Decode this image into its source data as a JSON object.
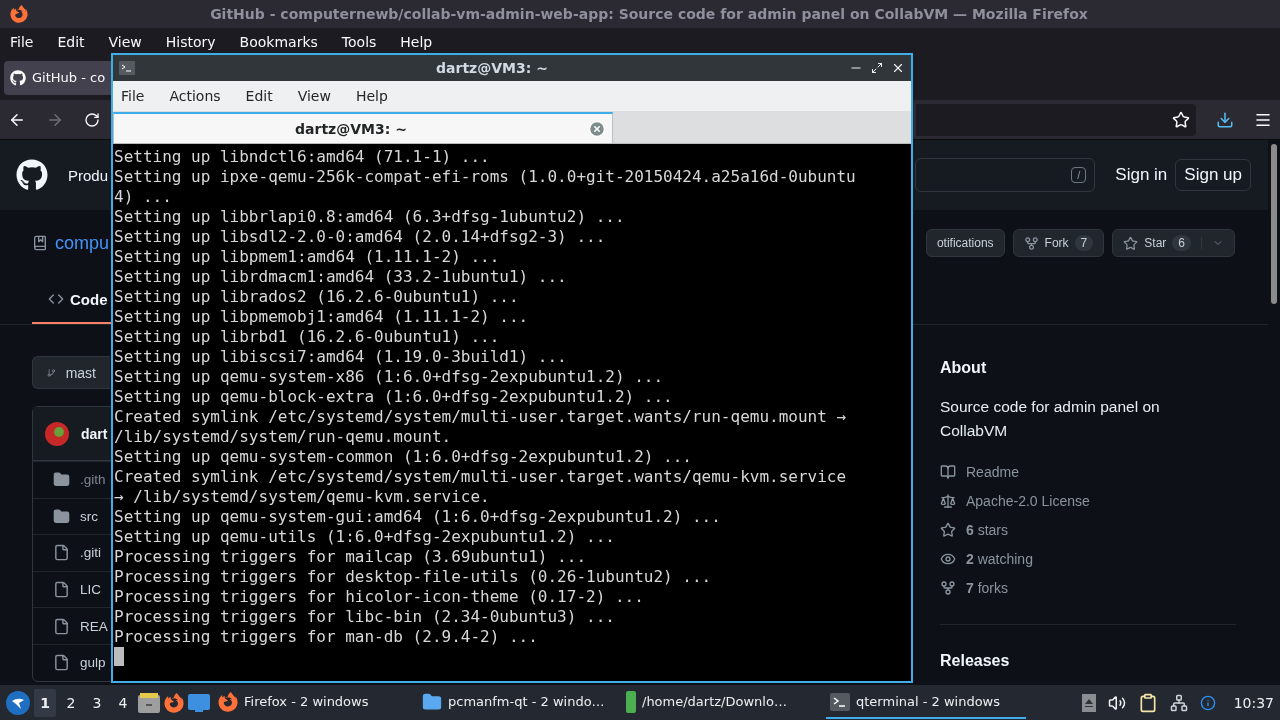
{
  "window": {
    "title": "GitHub - computernewb/collab-vm-admin-web-app: Source code for admin panel on CollabVM — Mozilla Firefox"
  },
  "menu": [
    "File",
    "Edit",
    "View",
    "History",
    "Bookmarks",
    "Tools",
    "Help"
  ],
  "browser_tabs": [
    {
      "label": "GitHub - co",
      "selected": true
    }
  ],
  "github": {
    "nav_item": "Produ",
    "search_key": "/",
    "sign_in": "Sign in",
    "sign_up": "Sign up",
    "repo_name": "compu",
    "actions": [
      {
        "kind": "notifications",
        "label": "otifications"
      },
      {
        "kind": "fork",
        "label": "Fork",
        "count": "7"
      },
      {
        "kind": "star",
        "label": "Star",
        "count": "6"
      }
    ],
    "tabs": [
      {
        "label": "Code",
        "selected": true
      }
    ],
    "branch": "mast",
    "commit_author": "dart",
    "files": [
      {
        "kind": "folder",
        "name": ".gith"
      },
      {
        "kind": "folder",
        "name": "src"
      },
      {
        "kind": "file",
        "name": ".giti"
      },
      {
        "kind": "file",
        "name": "LIC"
      },
      {
        "kind": "file",
        "name": "REA"
      },
      {
        "kind": "file",
        "name": "gulp"
      }
    ],
    "about": {
      "title": "About",
      "description": "Source code for admin panel on CollabVM",
      "links": [
        {
          "kind": "readme",
          "text": "Readme"
        },
        {
          "kind": "license",
          "text": "Apache-2.0 License"
        },
        {
          "kind": "stars",
          "text": "**6** stars"
        },
        {
          "kind": "watching",
          "text": "**2** watching"
        },
        {
          "kind": "forks",
          "text": "**7** forks"
        }
      ]
    },
    "releases": "Releases"
  },
  "terminal": {
    "title": "dartz@VM3: ~",
    "menu": [
      "File",
      "Actions",
      "Edit",
      "View",
      "Help"
    ],
    "tabs": [
      {
        "label": "dartz@VM3: ~",
        "selected": true
      }
    ],
    "lines": [
      "Setting up libndctl6:amd64 (71.1-1) ...",
      "Setting up ipxe-qemu-256k-compat-efi-roms (1.0.0+git-20150424.a25a16d-0ubuntu",
      "4) ...",
      "Setting up libbrlapi0.8:amd64 (6.3+dfsg-1ubuntu2) ...",
      "Setting up libsdl2-2.0-0:amd64 (2.0.14+dfsg2-3) ...",
      "Setting up libpmem1:amd64 (1.11.1-2) ...",
      "Setting up librdmacm1:amd64 (33.2-1ubuntu1) ...",
      "Setting up librados2 (16.2.6-0ubuntu1) ...",
      "Setting up libpmemobj1:amd64 (1.11.1-2) ...",
      "Setting up librbd1 (16.2.6-0ubuntu1) ...",
      "Setting up libiscsi7:amd64 (1.19.0-3build1) ...",
      "Setting up qemu-system-x86 (1:6.0+dfsg-2expubuntu1.2) ...",
      "Setting up qemu-block-extra (1:6.0+dfsg-2expubuntu1.2) ...",
      "Created symlink /etc/systemd/system/multi-user.target.wants/run-qemu.mount →",
      "/lib/systemd/system/run-qemu.mount.",
      "Setting up qemu-system-common (1:6.0+dfsg-2expubuntu1.2) ...",
      "Created symlink /etc/systemd/system/multi-user.target.wants/qemu-kvm.service",
      "→ /lib/systemd/system/qemu-kvm.service.",
      "Setting up qemu-system-gui:amd64 (1:6.0+dfsg-2expubuntu1.2) ...",
      "Setting up qemu-utils (1:6.0+dfsg-2expubuntu1.2) ...",
      "Processing triggers for mailcap (3.69ubuntu1) ...",
      "Processing triggers for desktop-file-utils (0.26-1ubuntu2) ...",
      "Processing triggers for hicolor-icon-theme (0.17-2) ...",
      "Processing triggers for libc-bin (2.34-0ubuntu3) ...",
      "Processing triggers for man-db (2.9.4-2) ..."
    ]
  },
  "taskbar": {
    "desktops": [
      {
        "label": "1",
        "selected": true
      },
      {
        "label": "2",
        "selected": false
      },
      {
        "label": "3",
        "selected": false
      },
      {
        "label": "4",
        "selected": false
      }
    ],
    "tasks": [
      {
        "kind": "firefox",
        "label": "Firefox - 2 windows",
        "selected": false
      },
      {
        "kind": "files",
        "label": "pcmanfm-qt - 2 windo…",
        "selected": false
      },
      {
        "kind": "archive",
        "label": "/home/dartz/Downlo…",
        "selected": false
      },
      {
        "kind": "terminal",
        "label": "qterminal - 2 windows",
        "selected": true
      }
    ],
    "clock": "10:37"
  }
}
